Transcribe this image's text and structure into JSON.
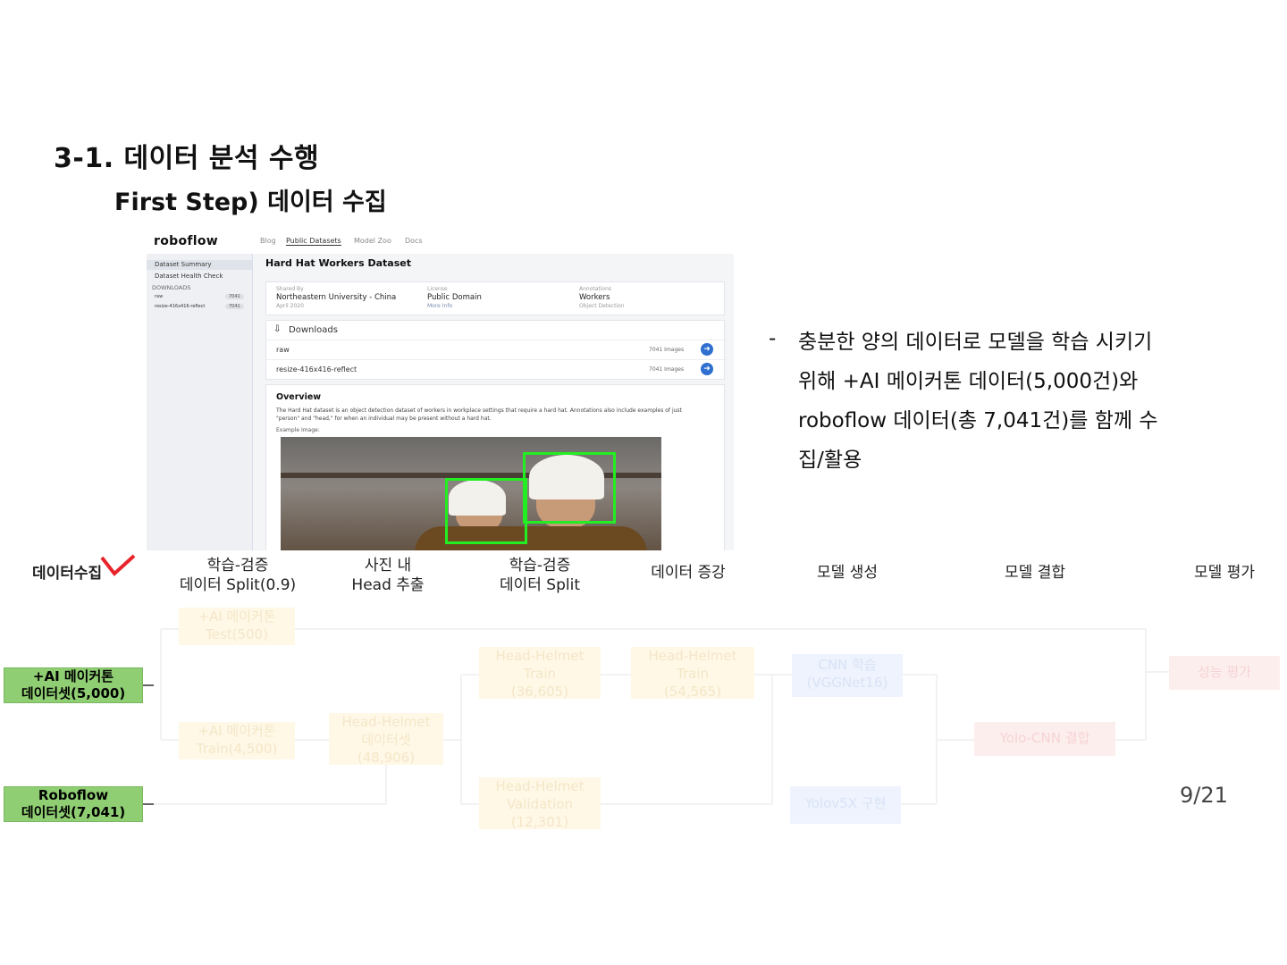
{
  "slide": {
    "title": "3-1. 데이터 분석 수행",
    "subtitle": "First Step) 데이터 수집",
    "page_number": "9/21"
  },
  "screenshot": {
    "logo": "roboflow",
    "nav": [
      "Blog",
      "Public Datasets",
      "Model Zoo",
      "Docs"
    ],
    "sidebar": {
      "items": [
        "Dataset Summary",
        "Dataset Health Check"
      ],
      "downloads_header": "DOWNLOADS",
      "downloads": [
        {
          "name": "raw",
          "count": "7041"
        },
        {
          "name": "resize-416x416-reflect",
          "count": "7041"
        }
      ]
    },
    "dataset_title": "Hard Hat Workers Dataset",
    "info": {
      "shared_by_label": "Shared By",
      "shared_by": "Northeastern University - China",
      "date": "April 2020",
      "license_label": "License",
      "license": "Public Domain",
      "more_info": "More Info",
      "annotations_label": "Annotations",
      "annotations": "Workers",
      "task": "Object Detection"
    },
    "downloads_title": "Downloads",
    "download_rows": [
      {
        "name": "raw",
        "count": "7041 Images"
      },
      {
        "name": "resize-416x416-reflect",
        "count": "7041 Images"
      }
    ],
    "overview_title": "Overview",
    "overview_text": "The Hard Hat dataset is an object detection dataset of workers in workplace settings that require a hard hat. Annotations also include examples of just \"person\" and \"head,\" for when an individual may be present without a hard hat.",
    "example_label": "Example Image:"
  },
  "bullet": {
    "dash": "-",
    "text": "충분한 양의 데이터로 모델을 학습 시키기 위해 +AI 메이커톤 데이터(5,000건)와 roboflow 데이터(총 7,041건)를 함께 수집/활용"
  },
  "pipeline": {
    "stages": {
      "s0": "데이터수집",
      "s1a": "학습-검증",
      "s1b": "데이터 Split(0.9)",
      "s2a": "사진 내",
      "s2b": "Head 추출",
      "s3a": "학습-검증",
      "s3b": "데이터 Split",
      "s4": "데이터 증강",
      "s5": "모델 생성",
      "s6": "모델 결합",
      "s7": "모델 평가"
    },
    "sources": {
      "aihack_a": "+AI 메이커톤",
      "aihack_b": "데이터셋(5,000)",
      "roboflow_a": "Roboflow",
      "roboflow_b": "데이터셋(7,041)"
    },
    "boxes": {
      "test_a": "+AI 메이커톤",
      "test_b": "Test(500)",
      "train_a": "+AI 메이커톤",
      "train_b": "Train(4,500)",
      "hh_a": "Head-Helmet",
      "hh_b": "데이터셋",
      "hh_c": "(48,906)",
      "hht_a": "Head-Helmet",
      "hht_b": "Train",
      "hht_c": "(36,605)",
      "hhv_a": "Head-Helmet",
      "hhv_b": "Validation",
      "hhv_c": "(12,301)",
      "aug_a": "Head-Helmet",
      "aug_b": "Train",
      "aug_c": "(54,565)",
      "cnn_a": "CNN 학습",
      "cnn_b": "(VGGNet16)",
      "yolo": "Yolov5X 구현",
      "combine": "Yolo-CNN 결합",
      "eval": "성능 평가"
    }
  }
}
